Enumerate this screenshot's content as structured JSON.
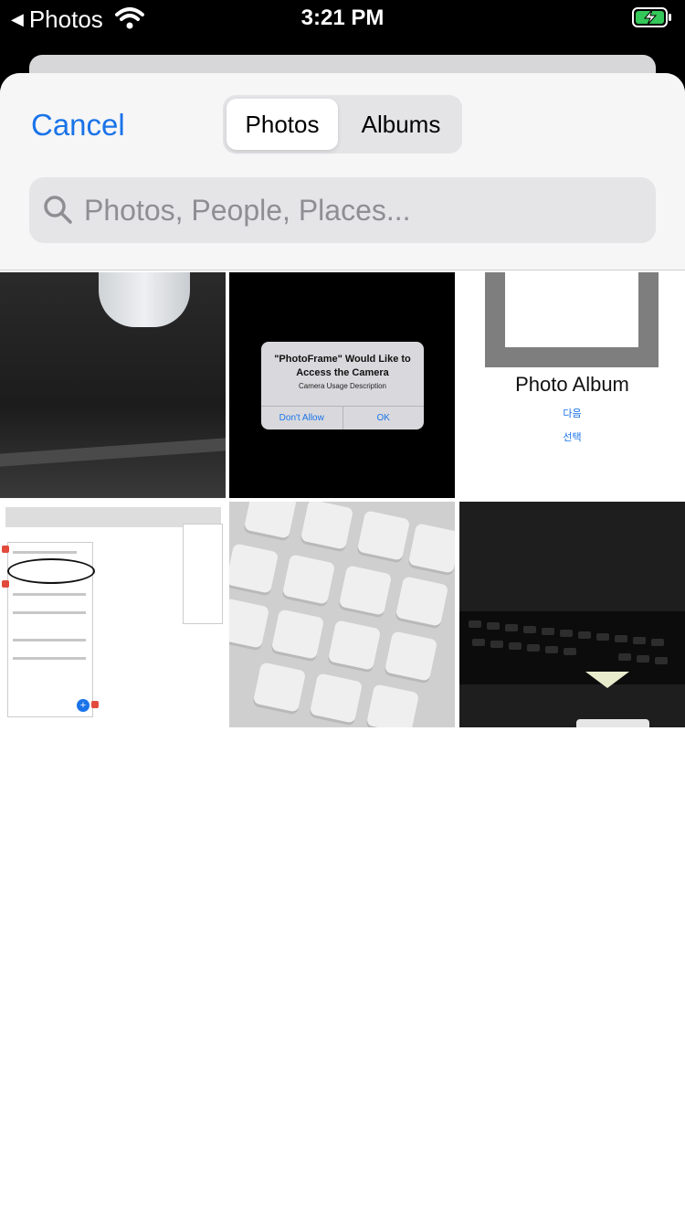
{
  "status_bar": {
    "back_app": "Photos",
    "time": "3:21 PM"
  },
  "header": {
    "cancel_label": "Cancel",
    "segments": [
      {
        "label": "Photos",
        "selected": true
      },
      {
        "label": "Albums",
        "selected": false
      }
    ],
    "search": {
      "placeholder": "Photos, People, Places..."
    }
  },
  "photos": {
    "alert": {
      "title": "\"PhotoFrame\" Would Like to Access the Camera",
      "message": "Camera Usage Description",
      "deny_label": "Don't Allow",
      "ok_label": "OK"
    },
    "album_card": {
      "title": "Photo Album",
      "next_label": "다음",
      "select_label": "선택"
    }
  },
  "colors": {
    "accent": "#1a73e8",
    "header_bg": "#f6f6f7",
    "battery_green": "#34c759"
  }
}
